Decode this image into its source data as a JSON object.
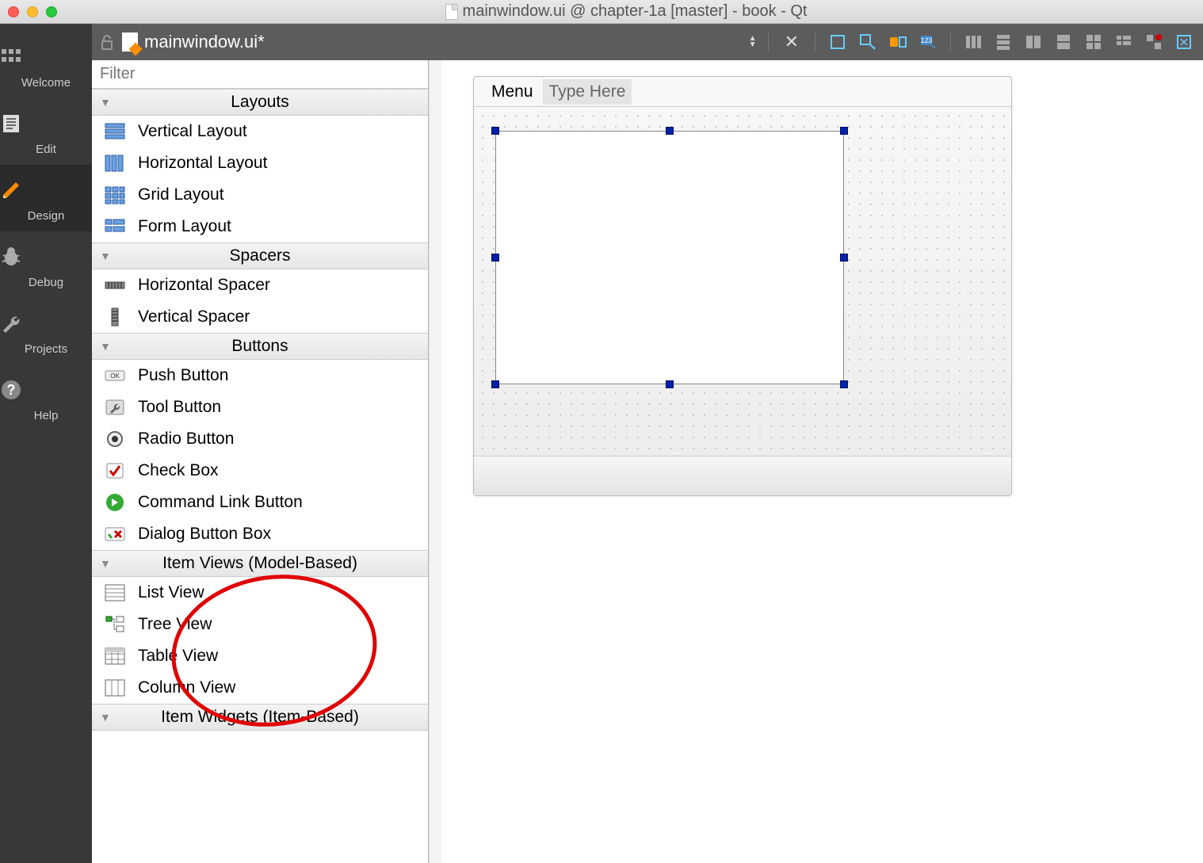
{
  "window": {
    "title": "mainwindow.ui @ chapter-1a [master] - book - Qt"
  },
  "darkbar": {
    "filename": "mainwindow.ui*"
  },
  "modes": {
    "welcome": "Welcome",
    "edit": "Edit",
    "design": "Design",
    "debug": "Debug",
    "projects": "Projects",
    "help": "Help"
  },
  "widgetbox": {
    "filter_placeholder": "Filter",
    "groups": [
      {
        "name": "Layouts",
        "items": [
          "Vertical Layout",
          "Horizontal Layout",
          "Grid Layout",
          "Form Layout"
        ]
      },
      {
        "name": "Spacers",
        "items": [
          "Horizontal Spacer",
          "Vertical Spacer"
        ]
      },
      {
        "name": "Buttons",
        "items": [
          "Push Button",
          "Tool Button",
          "Radio Button",
          "Check Box",
          "Command Link Button",
          "Dialog Button Box"
        ]
      },
      {
        "name": "Item Views (Model-Based)",
        "items": [
          "List View",
          "Tree View",
          "Table View",
          "Column View"
        ]
      },
      {
        "name": "Item Widgets (Item-Based)",
        "items": []
      }
    ]
  },
  "form": {
    "menu_label": "Menu",
    "type_here": "Type Here"
  }
}
